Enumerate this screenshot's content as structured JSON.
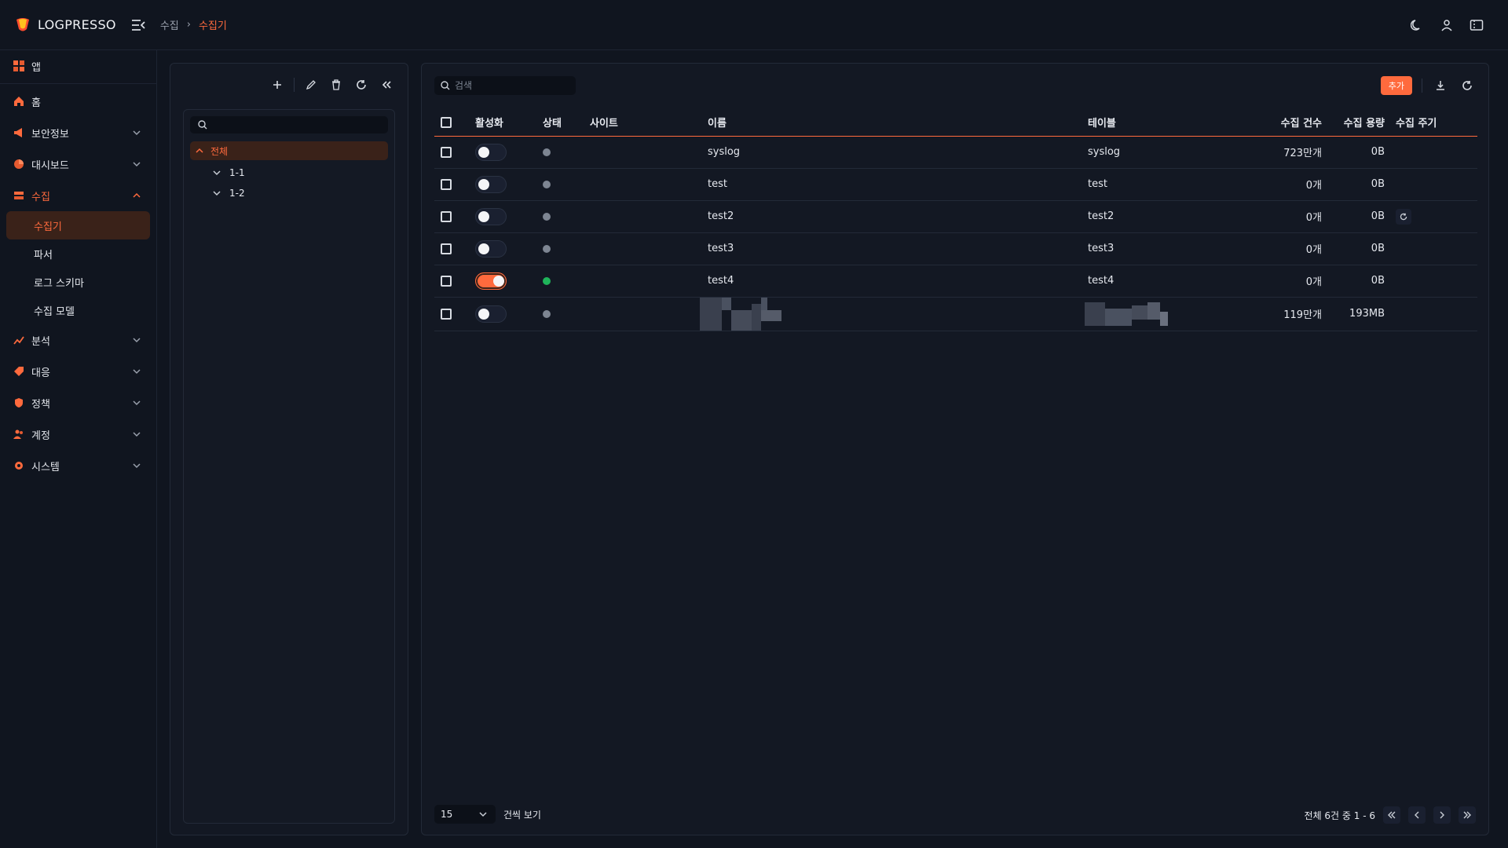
{
  "app": {
    "name": "LOGPRESSO"
  },
  "breadcrumb": {
    "parent": "수집",
    "current": "수집기"
  },
  "sidebar": {
    "apps": "앱",
    "items": [
      {
        "label": "홈",
        "icon": "home-icon"
      },
      {
        "label": "보안정보",
        "icon": "megaphone-icon"
      },
      {
        "label": "대시보드",
        "icon": "pie-chart-icon"
      },
      {
        "label": "수집",
        "icon": "inbox-icon"
      },
      {
        "label": "분석",
        "icon": "analytics-icon"
      },
      {
        "label": "대응",
        "icon": "tag-icon"
      },
      {
        "label": "정책",
        "icon": "shield-icon"
      },
      {
        "label": "계정",
        "icon": "users-icon"
      },
      {
        "label": "시스템",
        "icon": "gear-icon"
      }
    ],
    "sub": [
      "수집기",
      "파서",
      "로그 스키마",
      "수집 모델"
    ]
  },
  "tree": {
    "root": "전체",
    "nodes": [
      "1-1",
      "1-2"
    ]
  },
  "main": {
    "search_placeholder": "검색",
    "add_label": "추가",
    "columns": [
      "활성화",
      "상태",
      "사이트",
      "이름",
      "테이블",
      "수집 건수",
      "수집 용량",
      "수집 주기"
    ],
    "rows": [
      {
        "name": "syslog",
        "table": "syslog",
        "count": "723만개",
        "size": "0B",
        "enabled": false,
        "status": "gray"
      },
      {
        "name": "test",
        "table": "test",
        "count": "0개",
        "size": "0B",
        "enabled": false,
        "status": "gray"
      },
      {
        "name": "test2",
        "table": "test2",
        "count": "0개",
        "size": "0B",
        "enabled": false,
        "status": "gray"
      },
      {
        "name": "test3",
        "table": "test3",
        "count": "0개",
        "size": "0B",
        "enabled": false,
        "status": "gray"
      },
      {
        "name": "test4",
        "table": "test4",
        "count": "0개",
        "size": "0B",
        "enabled": true,
        "status": "green"
      },
      {
        "name": "",
        "table": "",
        "count": "119만개",
        "size": "193MB",
        "enabled": false,
        "status": "gray"
      }
    ]
  },
  "footer": {
    "page_size": "15",
    "page_size_label": "건씩 보기",
    "summary": "전체 6건 중 1 - 6"
  },
  "colors": {
    "accent": "#ff6a3d",
    "bg": "#10151f",
    "panel": "#131823",
    "active_bg": "#3a2219",
    "status_green": "#1fb45a"
  }
}
